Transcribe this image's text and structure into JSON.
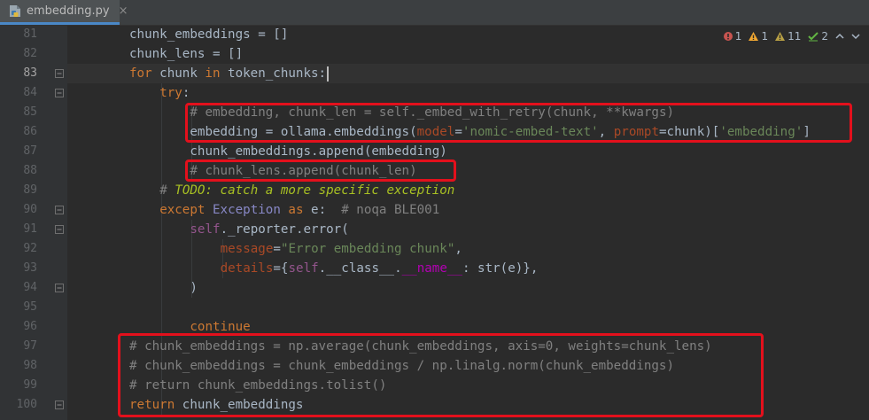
{
  "tab": {
    "filename": "embedding.py",
    "close": "×"
  },
  "inspections": {
    "errors": "1",
    "warnings": "1",
    "weak_warnings": "11",
    "typos": "2",
    "colors": {
      "error": "#c75450",
      "warning": "#f0a732",
      "weak": "#b8a044",
      "typo": "#62b543"
    }
  },
  "line_numbers": [
    "81",
    "82",
    "83",
    "84",
    "85",
    "86",
    "87",
    "88",
    "89",
    "90",
    "91",
    "92",
    "93",
    "94",
    "95",
    "96",
    "97",
    "98",
    "99",
    "100"
  ],
  "code": [
    [
      [
        "",
        "chunk_embeddings = []"
      ]
    ],
    [
      [
        "",
        "chunk_lens = []"
      ]
    ],
    [
      [
        "kw",
        "for"
      ],
      [
        "",
        " chunk "
      ],
      [
        "kw",
        "in"
      ],
      [
        "",
        " token_chunks:"
      ]
    ],
    [
      [
        "kw",
        "try"
      ],
      [
        "",
        ":"
      ]
    ],
    [
      [
        "cm",
        "# embedding, chunk_len = self._embed_with_retry(chunk, **kwargs)"
      ]
    ],
    [
      [
        "",
        "embedding = ollama.embeddings("
      ],
      [
        "pm",
        "model"
      ],
      [
        "",
        "="
      ],
      [
        "st",
        "'nomic-embed-text'"
      ],
      [
        "",
        ", "
      ],
      [
        "pm",
        "prompt"
      ],
      [
        "",
        "=chunk)["
      ],
      [
        "st",
        "'embedding'"
      ],
      [
        "",
        "]"
      ]
    ],
    [
      [
        "",
        "chunk_embeddings.append(embedding)"
      ]
    ],
    [
      [
        "cm",
        "# chunk_lens.append(chunk_len)"
      ]
    ],
    [
      [
        "cm",
        "# "
      ],
      [
        "todo",
        "TODO: catch a more specific exception"
      ]
    ],
    [
      [
        "kw",
        "except"
      ],
      [
        "",
        " "
      ],
      [
        "bi",
        "Exception"
      ],
      [
        "",
        " "
      ],
      [
        "kw",
        "as"
      ],
      [
        "",
        " e:  "
      ],
      [
        "cm",
        "# noqa BLE001"
      ]
    ],
    [
      [
        "sf",
        "self"
      ],
      [
        "",
        "._reporter.error("
      ]
    ],
    [
      [
        "pm",
        "message"
      ],
      [
        "",
        "="
      ],
      [
        "st",
        "\"Error embedding chunk\""
      ],
      [
        "",
        ","
      ]
    ],
    [
      [
        "pm",
        "details"
      ],
      [
        "",
        "={"
      ],
      [
        "sf",
        "self"
      ],
      [
        "",
        ".__class__."
      ],
      [
        "dn",
        "__name__"
      ],
      [
        "",
        ": str(e)},"
      ]
    ],
    [
      [
        "",
        ")"
      ]
    ],
    [],
    [
      [
        "kw",
        "continue"
      ]
    ],
    [
      [
        "cm",
        "# chunk_embeddings = np.average(chunk_embeddings, axis=0, weights=chunk_lens)"
      ]
    ],
    [
      [
        "cm",
        "# chunk_embeddings = chunk_embeddings / np.linalg.norm(chunk_embeddings)"
      ]
    ],
    [
      [
        "cm",
        "# return chunk_embeddings.tolist()"
      ]
    ],
    [
      [
        "kw",
        "return"
      ],
      [
        "",
        " chunk_embeddings"
      ]
    ]
  ]
}
